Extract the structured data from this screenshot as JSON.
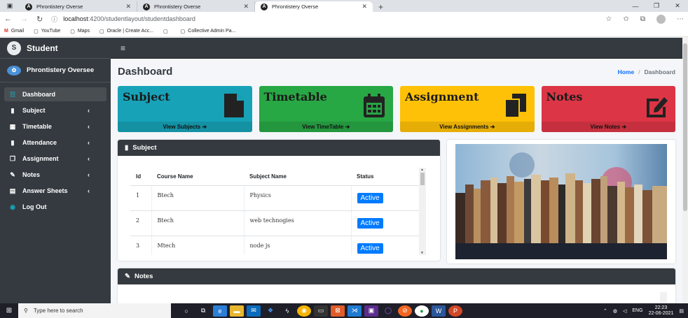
{
  "browser": {
    "tabs": [
      {
        "title": "Phrontistery Overse"
      },
      {
        "title": "Phrontistery Overse"
      },
      {
        "title": "Phrontistery Overse"
      }
    ],
    "url_host": "localhost",
    "url_path": ":4200/studentlayout/studentdashboard",
    "bookmarks": [
      "Gmail",
      "YouTube",
      "Maps",
      "Oracle | Create Acc...",
      "",
      "Collective Admin Pa..."
    ]
  },
  "sidebar": {
    "brand": "Student",
    "brand_initial": "S",
    "org_name": "Phrontistery Oversee",
    "items": [
      {
        "label": "Dashboard",
        "icon": "dashboard-icon",
        "glyph": "☷",
        "active": true,
        "chevron": ""
      },
      {
        "label": "Subject",
        "icon": "file-icon",
        "glyph": "▮",
        "active": false,
        "chevron": "‹"
      },
      {
        "label": "Timetable",
        "icon": "calendar-icon",
        "glyph": "▦",
        "active": false,
        "chevron": "‹"
      },
      {
        "label": "Attendance",
        "icon": "clipboard-icon",
        "glyph": "▮",
        "active": false,
        "chevron": "‹"
      },
      {
        "label": "Assignment",
        "icon": "copy-icon",
        "glyph": "❐",
        "active": false,
        "chevron": "‹"
      },
      {
        "label": "Notes",
        "icon": "edit-icon",
        "glyph": "✎",
        "active": false,
        "chevron": "‹"
      },
      {
        "label": "Answer Sheets",
        "icon": "list-icon",
        "glyph": "▤",
        "active": false,
        "chevron": "‹"
      },
      {
        "label": "Log Out",
        "icon": "logout-icon",
        "glyph": "◉",
        "active": false,
        "chevron": ""
      }
    ]
  },
  "header": {
    "title": "Dashboard",
    "breadcrumb_home": "Home",
    "breadcrumb_sep": "/",
    "breadcrumb_current": "Dashboard"
  },
  "cards": [
    {
      "title": "Subject",
      "link": "View Subjects ➔"
    },
    {
      "title": "Timetable",
      "link": "View TimeTable ➔"
    },
    {
      "title": "Assignment",
      "link": "View Assignments ➔"
    },
    {
      "title": "Notes",
      "link": "View Notes ➔"
    }
  ],
  "subject_panel": {
    "title": "Subject",
    "columns": [
      "Id",
      "Course Name",
      "Subject Name",
      "Status"
    ],
    "rows": [
      {
        "id": "1",
        "course": "Btech",
        "subject": "Physics",
        "status": "Active"
      },
      {
        "id": "2",
        "course": "Btech",
        "subject": "web technogies",
        "status": "Active"
      },
      {
        "id": "3",
        "course": "Mtech",
        "subject": "node js",
        "status": "Active"
      }
    ]
  },
  "notes_panel": {
    "title": "Notes"
  },
  "taskbar": {
    "search_placeholder": "Type here to search",
    "lang": "ENG",
    "time": "22:23",
    "date": "22-06-2021"
  },
  "colors": {
    "subject": "#17a2b8",
    "timetable": "#28a745",
    "assignment": "#ffc107",
    "notes": "#dc3545",
    "sidebar": "#343a40",
    "status_button": "#007bff"
  }
}
